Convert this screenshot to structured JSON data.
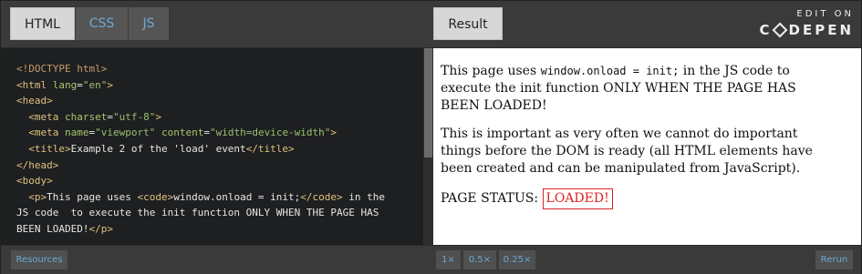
{
  "tabs": {
    "html": "HTML",
    "css": "CSS",
    "js": "JS",
    "result": "Result"
  },
  "brand": {
    "edit_on": "EDIT ON",
    "name_pre": "C",
    "name_post": "DEPEN"
  },
  "code_lines": [
    "<!DOCTYPE html>",
    "<html lang=\"en\">",
    "<head>",
    "  <meta charset=\"utf-8\">",
    "  <meta name=\"viewport\" content=\"width=device-width\">",
    "  <title>Example 2 of the 'load' event</title>",
    "</head>",
    "<body>",
    "  <p>This page uses <code>window.onload = init;</code> in the",
    "JS code  to execute the init function ONLY WHEN THE PAGE HAS",
    "BEEN LOADED!</p>"
  ],
  "result": {
    "p1_a": "This page uses ",
    "p1_code": "window.onload = init;",
    "p1_b": " in the JS code to execute the init function ONLY WHEN THE PAGE HAS BEEN LOADED!",
    "p2": "This is important as very often we cannot do important things before the DOM is ready (all HTML elements have been created and can be manipulated from JavaScript).",
    "status_label": "PAGE STATUS: ",
    "status_value": "LOADED!"
  },
  "bottom": {
    "resources": "Resources",
    "zoom_1x": "1×",
    "zoom_05x": "0.5×",
    "zoom_025x": "0.25×",
    "rerun": "Rerun"
  },
  "colors": {
    "accent": "#6aa9d6",
    "status": "#dd2222",
    "editor_bg": "#1d1f21"
  }
}
